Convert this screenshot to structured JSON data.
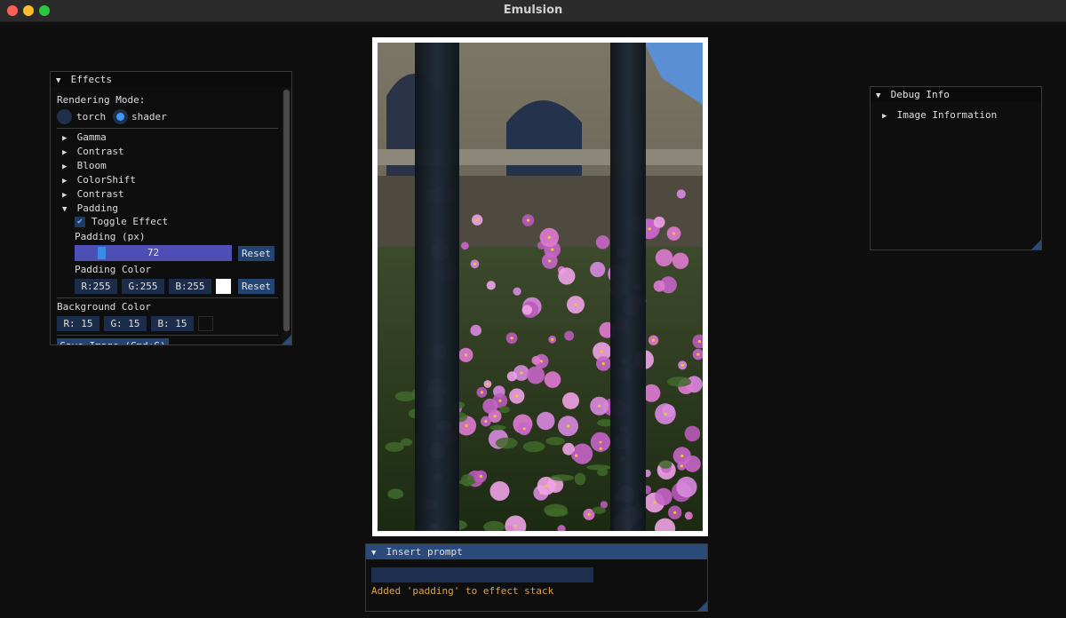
{
  "app": {
    "title": "Emulsion"
  },
  "effects_panel": {
    "title": "Effects",
    "rendering_mode_label": "Rendering Mode:",
    "modes": [
      {
        "label": "torch",
        "selected": false
      },
      {
        "label": "shader",
        "selected": true
      }
    ],
    "effects": [
      {
        "label": "Gamma",
        "expanded": false
      },
      {
        "label": "Contrast",
        "expanded": false
      },
      {
        "label": "Bloom",
        "expanded": false
      },
      {
        "label": "ColorShift",
        "expanded": false
      },
      {
        "label": "Contrast",
        "expanded": false
      },
      {
        "label": "Padding",
        "expanded": true
      }
    ],
    "padding": {
      "toggle_label": "Toggle Effect",
      "toggle_checked": true,
      "padding_label": "Padding (px)",
      "padding_value": "72",
      "padding_min": 0,
      "padding_max": 500,
      "reset_label": "Reset",
      "color_label": "Padding Color",
      "r": "R:255",
      "g": "G:255",
      "b": "B:255",
      "swatch_color": "#ffffff",
      "color_reset_label": "Reset"
    },
    "background": {
      "label": "Background Color",
      "r": "R: 15",
      "g": "G: 15",
      "b": "B: 15",
      "swatch_color": "#0f0f0f"
    },
    "save_button": "Save Image (Cmd+S)"
  },
  "debug_panel": {
    "title": "Debug Info",
    "items": [
      {
        "label": "Image Information",
        "expanded": false
      }
    ]
  },
  "prompt_panel": {
    "title": "Insert prompt",
    "input_value": "",
    "message": "Added 'padding' to effect stack"
  },
  "colors": {
    "background": "#0f0f0f",
    "accent": "#294a7a",
    "button": "#234471",
    "slider": "#4d4fb5",
    "message": "#e0a43c"
  }
}
